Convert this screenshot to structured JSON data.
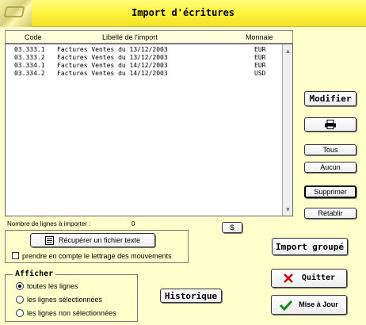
{
  "window": {
    "title": "Import d'écritures"
  },
  "list": {
    "columns": {
      "code": "Code",
      "label": "Libellé de l'import",
      "currency": "Monnaie"
    },
    "rows": [
      {
        "code": "03.333.1",
        "label": "Factures Ventes du 13/12/2003",
        "currency": "EUR"
      },
      {
        "code": "03.333.2",
        "label": "Factures Ventes du 13/12/2003",
        "currency": "EUR"
      },
      {
        "code": "03.334.1",
        "label": "Factures Ventes du 14/12/2003",
        "currency": "EUR"
      },
      {
        "code": "03.334.2",
        "label": "Factures Ventes du 14/12/2003",
        "currency": "USD"
      }
    ],
    "scroll_up": "▲",
    "scroll_down": "▼"
  },
  "side": {
    "modifier": "Modifier",
    "print_icon": "printer-icon",
    "tous": "Tous",
    "aucun": "Aucun",
    "supprimer": "Supprimer",
    "retablir": "Rétablir"
  },
  "count": {
    "label": "Nombre de lignes à importer :",
    "value": "0"
  },
  "dollar": "$",
  "file": {
    "button": "Récupérer un fichier texte",
    "icon": "file-icon",
    "checkbox_label": "prendre en compte le lettrage des mouvements",
    "checkbox_checked": false
  },
  "show": {
    "title": "Afficher",
    "options": [
      {
        "label": "toutes les lignes",
        "selected": true
      },
      {
        "label": "les lignes sélectionnées",
        "selected": false
      },
      {
        "label": "les lignes non sélectionnées",
        "selected": false
      }
    ]
  },
  "buttons": {
    "historique": "Historique",
    "import_groupe": "Import groupé",
    "quitter": "Quitter",
    "mise_a_jour": "Mise à Jour"
  },
  "colors": {
    "banner": "#fff23a",
    "background": "#ffffcc",
    "quit_icon": "#d40000",
    "ok_icon": "#1a8a1a"
  }
}
